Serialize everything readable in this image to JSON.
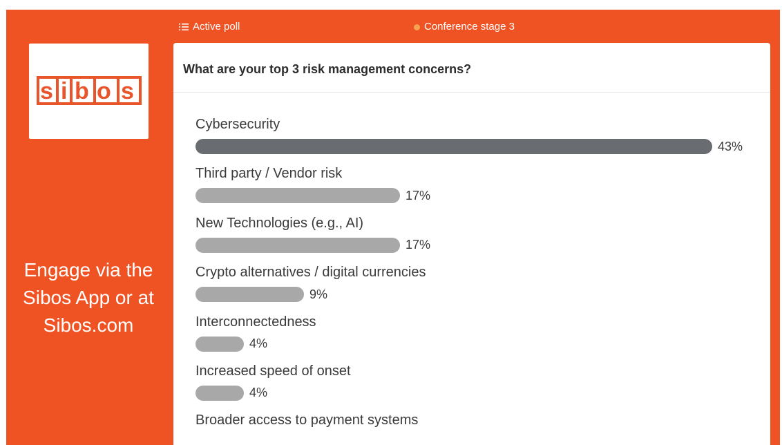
{
  "topbar": {
    "active_poll_label": "Active poll",
    "stage_label": "Conference stage 3"
  },
  "sidebar": {
    "logo_text": "sibos",
    "engage_lines": [
      "Engage via the",
      "Sibos App or at",
      "Sibos.com"
    ]
  },
  "poll": {
    "question": "What are your top 3 risk management concerns?",
    "options": [
      {
        "label": "Cybersecurity",
        "percent": 43,
        "percent_label": "43%"
      },
      {
        "label": "Third party / Vendor risk",
        "percent": 17,
        "percent_label": "17%"
      },
      {
        "label": "New Technologies (e.g., AI)",
        "percent": 17,
        "percent_label": "17%"
      },
      {
        "label": "Crypto alternatives / digital currencies",
        "percent": 9,
        "percent_label": "9%"
      },
      {
        "label": "Interconnectedness",
        "percent": 4,
        "percent_label": "4%"
      },
      {
        "label": "Increased speed of onset",
        "percent": 4,
        "percent_label": "4%"
      },
      {
        "label": "Broader access to payment systems",
        "percent": null,
        "percent_label": null
      }
    ]
  },
  "colors": {
    "brand_orange": "#f05323",
    "dot_orange": "#f7a250",
    "top_bar": "#696c70",
    "other_bar": "#a8a8a8"
  },
  "icons": {
    "poll_list": "list-icon",
    "stage_dot": "status-dot-icon"
  }
}
